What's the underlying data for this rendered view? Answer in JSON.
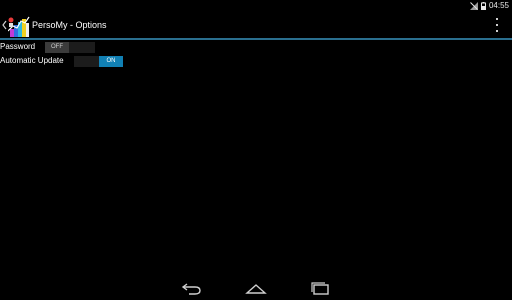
{
  "status_bar": {
    "time": "04:55",
    "icons": [
      "signal-off-icon",
      "battery-icon"
    ]
  },
  "action_bar": {
    "up_icon": "chevron-left-icon",
    "app_icon": "persomy-app-icon",
    "title": "PersoMy - Options",
    "overflow_icon": "overflow-menu-icon",
    "divider_color": "#2a6f8f"
  },
  "settings": {
    "password": {
      "label": "Password",
      "state": "OFF"
    },
    "automatic_update": {
      "label": "Automatic Update",
      "state": "ON"
    }
  },
  "colors": {
    "switch_on": "#1180b4",
    "switch_off": "#3b3b3b",
    "background": "#000000"
  },
  "nav_bar": {
    "buttons": [
      "back-icon",
      "home-icon",
      "recents-icon"
    ]
  }
}
